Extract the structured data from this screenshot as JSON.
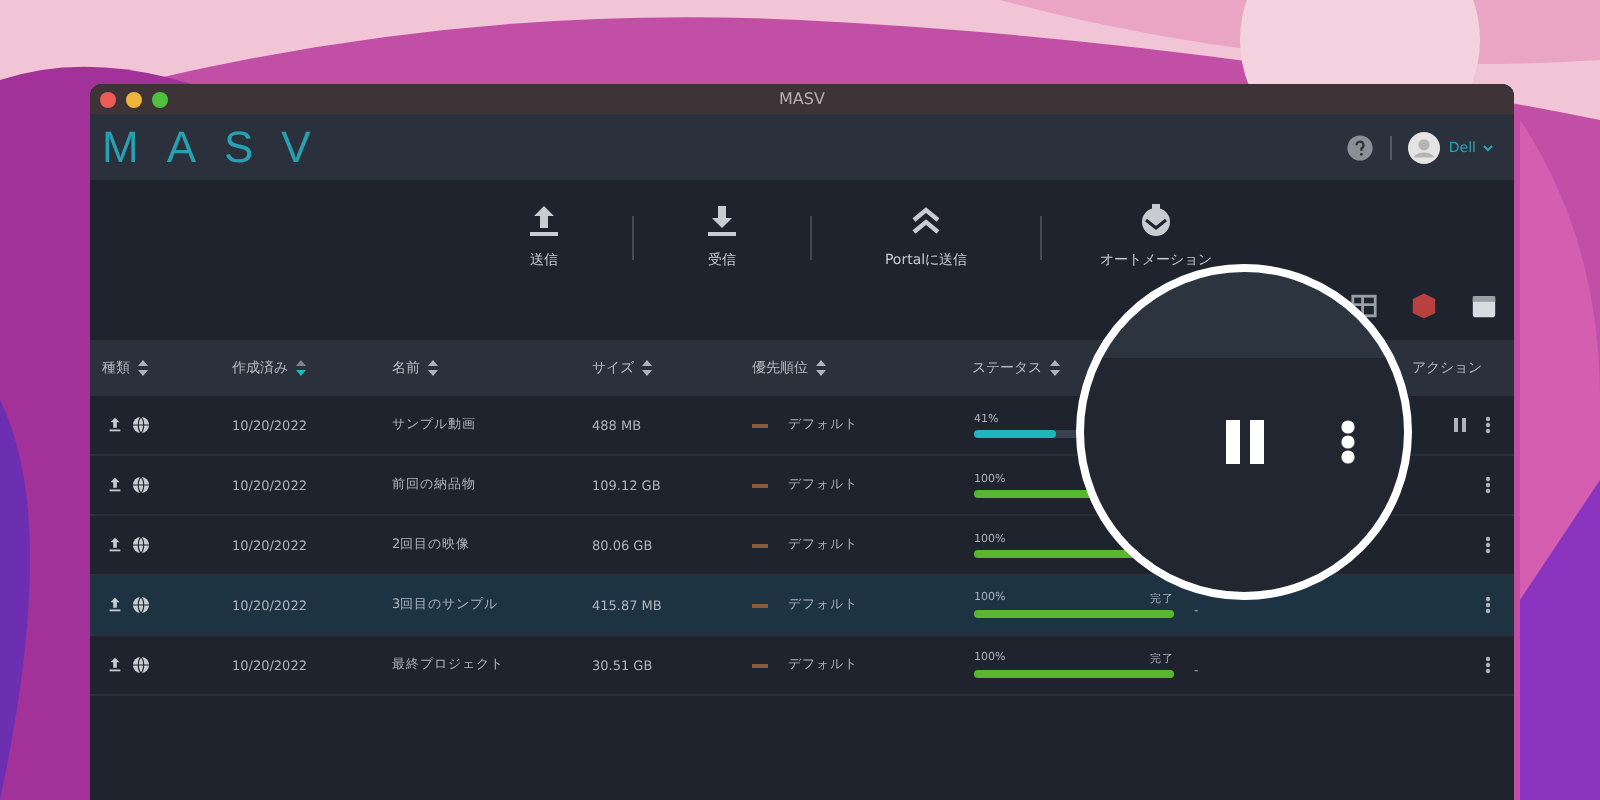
{
  "window": {
    "title": "MASV"
  },
  "header": {
    "logo": "MASV",
    "user": "Dell"
  },
  "toolbar": [
    {
      "label": "送信",
      "kind": "upload"
    },
    {
      "label": "受信",
      "kind": "download"
    },
    {
      "label": "Portalに送信",
      "kind": "portal"
    },
    {
      "label": "オートメーション",
      "kind": "automation"
    }
  ],
  "tools": [
    {
      "kind": "grid"
    },
    {
      "kind": "badge",
      "color": "#b8403e"
    },
    {
      "kind": "calendar"
    }
  ],
  "table": {
    "columns": [
      {
        "label": "種類",
        "sorted": false
      },
      {
        "label": "作成済み",
        "sorted": true
      },
      {
        "label": "名前",
        "sorted": false
      },
      {
        "label": "サイズ",
        "sorted": false
      },
      {
        "label": "優先順位",
        "sorted": false
      },
      {
        "label": "ステータス",
        "sorted": false
      },
      {
        "label": "アクション"
      }
    ],
    "rows": [
      {
        "date": "10/20/2022",
        "name": "サンプル動画",
        "size": "488 MB",
        "priority": "デフォルト",
        "percent": "41%",
        "level": 0.41,
        "kind": "active",
        "selected": false,
        "actions": [
          {
            "kind": "pause"
          },
          {
            "kind": "more"
          }
        ]
      },
      {
        "date": "10/20/2022",
        "name": "前回の納品物",
        "size": "109.12 GB",
        "priority": "デフォルト",
        "percent": "100%",
        "level": 1,
        "kind": "done",
        "selected": false,
        "actions": [
          {
            "kind": "more"
          }
        ]
      },
      {
        "date": "10/20/2022",
        "name": "2回目の映像",
        "size": "80.06 GB",
        "priority": "デフォルト",
        "percent": "100%",
        "level": 1,
        "kind": "done",
        "selected": false,
        "actions": [
          {
            "kind": "more"
          }
        ]
      },
      {
        "date": "10/20/2022",
        "name": "3回目のサンプル",
        "size": "415.87 MB",
        "priority": "デフォルト",
        "percent": "100%",
        "level": 1,
        "kind": "done",
        "state_text": "完了",
        "detail": "-",
        "selected": true,
        "actions": [
          {
            "kind": "more"
          }
        ]
      },
      {
        "date": "10/20/2022",
        "name": "最終プロジェクト",
        "size": "30.51 GB",
        "priority": "デフォルト",
        "percent": "100%",
        "level": 1,
        "kind": "done",
        "state_text": "完了",
        "detail": "-",
        "selected": false,
        "actions": [
          {
            "kind": "more"
          }
        ]
      }
    ]
  },
  "magnifier": {
    "actions": [
      {
        "kind": "pause"
      },
      {
        "kind": "more"
      }
    ]
  }
}
